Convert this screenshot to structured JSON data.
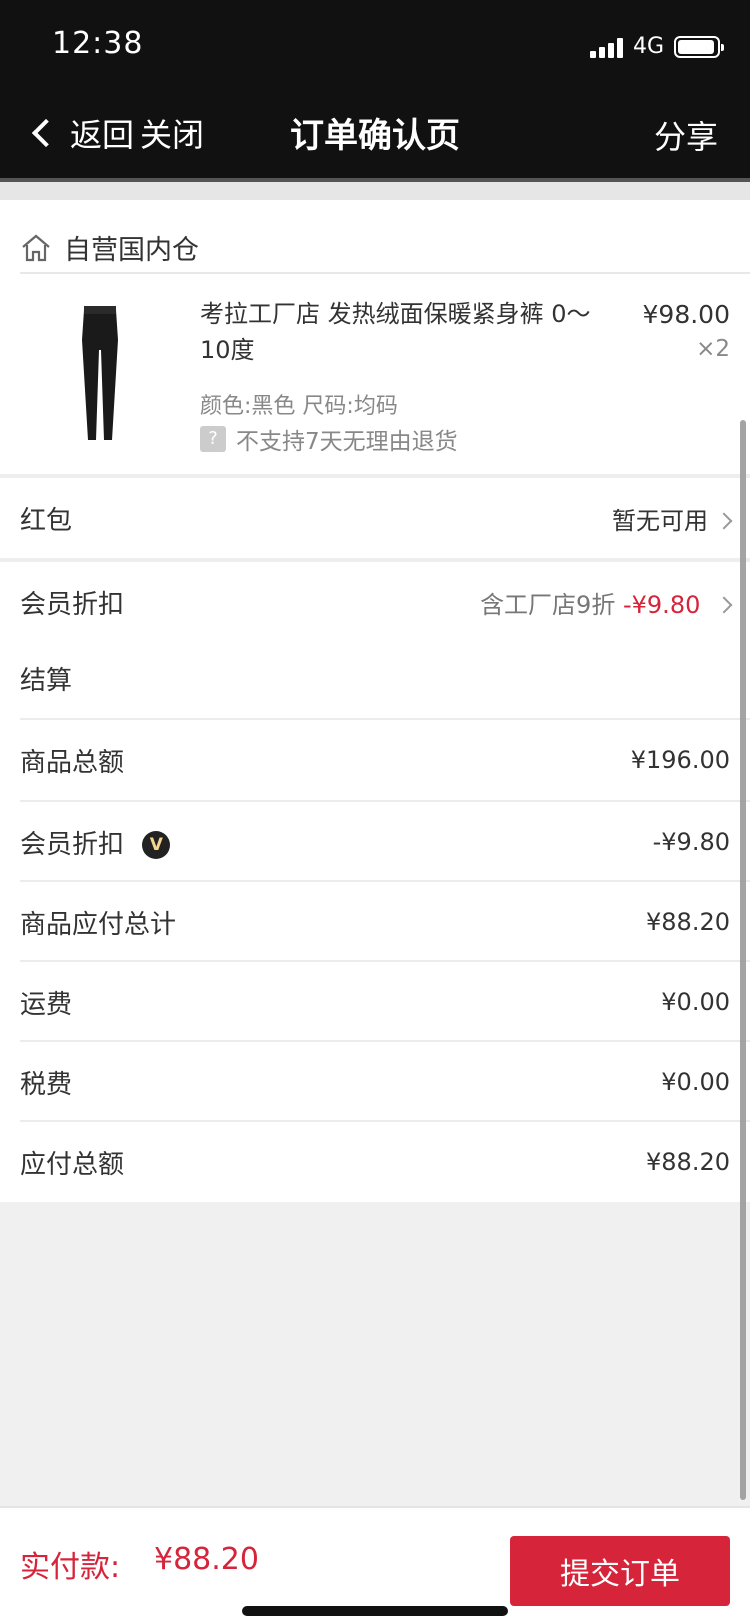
{
  "status_bar": {
    "time": "12:38",
    "network": "4G",
    "battery_level": 0.85
  },
  "nav": {
    "back_label": "返回",
    "close_label": "关闭",
    "title": "订单确认页",
    "share_label": "分享"
  },
  "warehouse": {
    "name": "自营国内仓",
    "product": {
      "title": "考拉工厂店 发热绒面保暖紧身裤 0～10度",
      "price": "¥98.00",
      "quantity": "×2",
      "spec": "颜色:黑色 尺码:均码",
      "policy_icon": "?",
      "policy": "不支持7天无理由退货"
    }
  },
  "red_packet": {
    "label": "红包",
    "value": "暂无可用"
  },
  "member_discount": {
    "label": "会员折扣",
    "desc": "含工厂店9折",
    "amount": "-¥9.80"
  },
  "settlement": {
    "title": "结算",
    "rows": [
      {
        "label": "商品总额",
        "value": "¥196.00"
      },
      {
        "label": "会员折扣",
        "value": "-¥9.80",
        "badge": "V"
      },
      {
        "label": "商品应付总计",
        "value": "¥88.20"
      },
      {
        "label": "运费",
        "value": "¥0.00"
      },
      {
        "label": "税费",
        "value": "¥0.00"
      },
      {
        "label": "应付总额",
        "value": "¥88.20"
      }
    ]
  },
  "bottom": {
    "pay_label": "实付款:",
    "pay_amount": "¥88.20",
    "submit_label": "提交订单"
  },
  "colors": {
    "accent": "#d6243a",
    "topbar": "#111111"
  }
}
